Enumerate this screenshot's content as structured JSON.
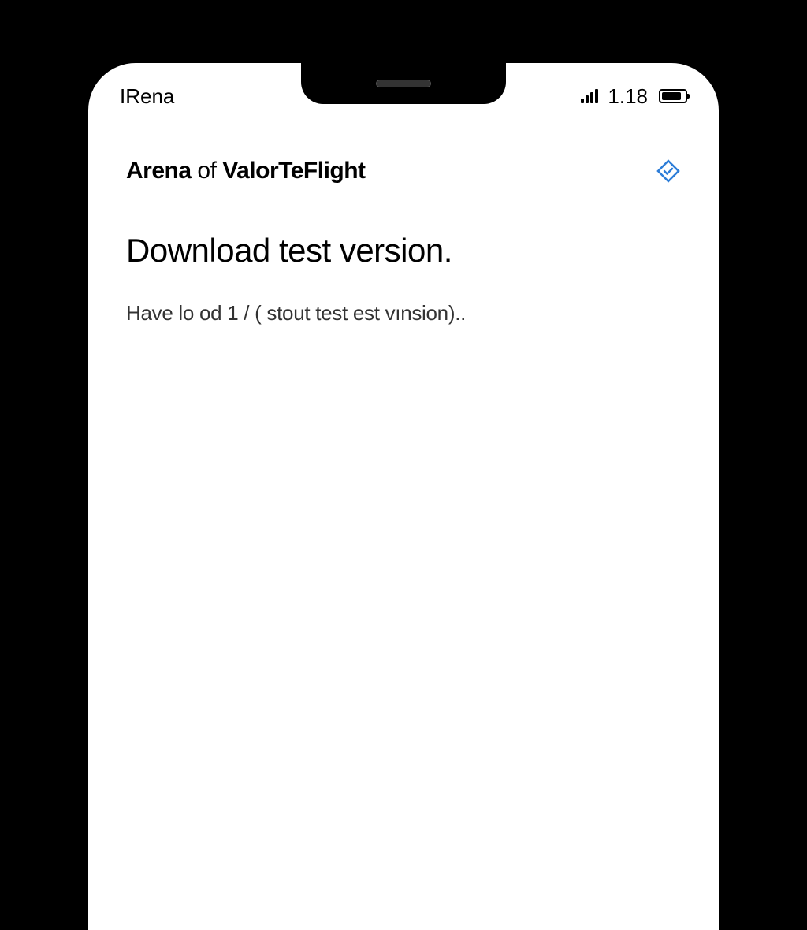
{
  "status_bar": {
    "carrier": "IRena",
    "time_label": "1.18"
  },
  "header": {
    "title_part1": "Arena",
    "title_part2": " of ",
    "title_part3": "Valor",
    "title_part4": "TeFlight"
  },
  "content": {
    "heading": "Download test version.",
    "subtext": "Have lo od 1 / ( stout test est vınsion).."
  },
  "colors": {
    "accent": "#2d7dd8"
  }
}
